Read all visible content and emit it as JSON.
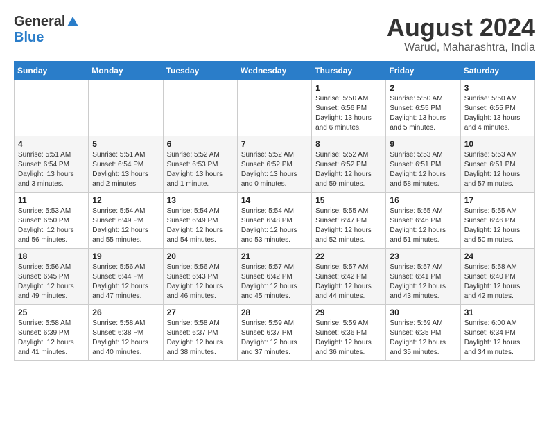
{
  "header": {
    "logo_general": "General",
    "logo_blue": "Blue",
    "title": "August 2024",
    "location": "Warud, Maharashtra, India"
  },
  "weekdays": [
    "Sunday",
    "Monday",
    "Tuesday",
    "Wednesday",
    "Thursday",
    "Friday",
    "Saturday"
  ],
  "weeks": [
    [
      {
        "day": "",
        "info": ""
      },
      {
        "day": "",
        "info": ""
      },
      {
        "day": "",
        "info": ""
      },
      {
        "day": "",
        "info": ""
      },
      {
        "day": "1",
        "info": "Sunrise: 5:50 AM\nSunset: 6:56 PM\nDaylight: 13 hours\nand 6 minutes."
      },
      {
        "day": "2",
        "info": "Sunrise: 5:50 AM\nSunset: 6:55 PM\nDaylight: 13 hours\nand 5 minutes."
      },
      {
        "day": "3",
        "info": "Sunrise: 5:50 AM\nSunset: 6:55 PM\nDaylight: 13 hours\nand 4 minutes."
      }
    ],
    [
      {
        "day": "4",
        "info": "Sunrise: 5:51 AM\nSunset: 6:54 PM\nDaylight: 13 hours\nand 3 minutes."
      },
      {
        "day": "5",
        "info": "Sunrise: 5:51 AM\nSunset: 6:54 PM\nDaylight: 13 hours\nand 2 minutes."
      },
      {
        "day": "6",
        "info": "Sunrise: 5:52 AM\nSunset: 6:53 PM\nDaylight: 13 hours\nand 1 minute."
      },
      {
        "day": "7",
        "info": "Sunrise: 5:52 AM\nSunset: 6:52 PM\nDaylight: 13 hours\nand 0 minutes."
      },
      {
        "day": "8",
        "info": "Sunrise: 5:52 AM\nSunset: 6:52 PM\nDaylight: 12 hours\nand 59 minutes."
      },
      {
        "day": "9",
        "info": "Sunrise: 5:53 AM\nSunset: 6:51 PM\nDaylight: 12 hours\nand 58 minutes."
      },
      {
        "day": "10",
        "info": "Sunrise: 5:53 AM\nSunset: 6:51 PM\nDaylight: 12 hours\nand 57 minutes."
      }
    ],
    [
      {
        "day": "11",
        "info": "Sunrise: 5:53 AM\nSunset: 6:50 PM\nDaylight: 12 hours\nand 56 minutes."
      },
      {
        "day": "12",
        "info": "Sunrise: 5:54 AM\nSunset: 6:49 PM\nDaylight: 12 hours\nand 55 minutes."
      },
      {
        "day": "13",
        "info": "Sunrise: 5:54 AM\nSunset: 6:49 PM\nDaylight: 12 hours\nand 54 minutes."
      },
      {
        "day": "14",
        "info": "Sunrise: 5:54 AM\nSunset: 6:48 PM\nDaylight: 12 hours\nand 53 minutes."
      },
      {
        "day": "15",
        "info": "Sunrise: 5:55 AM\nSunset: 6:47 PM\nDaylight: 12 hours\nand 52 minutes."
      },
      {
        "day": "16",
        "info": "Sunrise: 5:55 AM\nSunset: 6:46 PM\nDaylight: 12 hours\nand 51 minutes."
      },
      {
        "day": "17",
        "info": "Sunrise: 5:55 AM\nSunset: 6:46 PM\nDaylight: 12 hours\nand 50 minutes."
      }
    ],
    [
      {
        "day": "18",
        "info": "Sunrise: 5:56 AM\nSunset: 6:45 PM\nDaylight: 12 hours\nand 49 minutes."
      },
      {
        "day": "19",
        "info": "Sunrise: 5:56 AM\nSunset: 6:44 PM\nDaylight: 12 hours\nand 47 minutes."
      },
      {
        "day": "20",
        "info": "Sunrise: 5:56 AM\nSunset: 6:43 PM\nDaylight: 12 hours\nand 46 minutes."
      },
      {
        "day": "21",
        "info": "Sunrise: 5:57 AM\nSunset: 6:42 PM\nDaylight: 12 hours\nand 45 minutes."
      },
      {
        "day": "22",
        "info": "Sunrise: 5:57 AM\nSunset: 6:42 PM\nDaylight: 12 hours\nand 44 minutes."
      },
      {
        "day": "23",
        "info": "Sunrise: 5:57 AM\nSunset: 6:41 PM\nDaylight: 12 hours\nand 43 minutes."
      },
      {
        "day": "24",
        "info": "Sunrise: 5:58 AM\nSunset: 6:40 PM\nDaylight: 12 hours\nand 42 minutes."
      }
    ],
    [
      {
        "day": "25",
        "info": "Sunrise: 5:58 AM\nSunset: 6:39 PM\nDaylight: 12 hours\nand 41 minutes."
      },
      {
        "day": "26",
        "info": "Sunrise: 5:58 AM\nSunset: 6:38 PM\nDaylight: 12 hours\nand 40 minutes."
      },
      {
        "day": "27",
        "info": "Sunrise: 5:58 AM\nSunset: 6:37 PM\nDaylight: 12 hours\nand 38 minutes."
      },
      {
        "day": "28",
        "info": "Sunrise: 5:59 AM\nSunset: 6:37 PM\nDaylight: 12 hours\nand 37 minutes."
      },
      {
        "day": "29",
        "info": "Sunrise: 5:59 AM\nSunset: 6:36 PM\nDaylight: 12 hours\nand 36 minutes."
      },
      {
        "day": "30",
        "info": "Sunrise: 5:59 AM\nSunset: 6:35 PM\nDaylight: 12 hours\nand 35 minutes."
      },
      {
        "day": "31",
        "info": "Sunrise: 6:00 AM\nSunset: 6:34 PM\nDaylight: 12 hours\nand 34 minutes."
      }
    ]
  ]
}
